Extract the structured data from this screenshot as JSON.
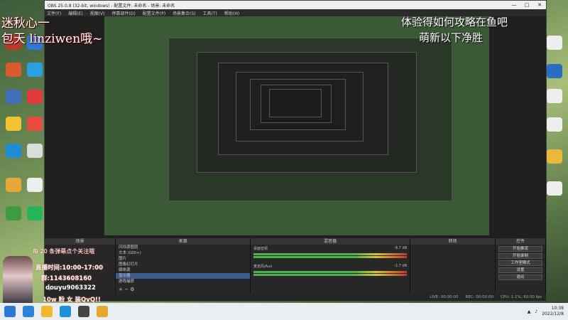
{
  "window": {
    "title": "OBS 25.0.8 (32-bit, windows) - 配置文件: 未命名 - 场景: 未命名",
    "controls": [
      "—",
      "□",
      "✕"
    ]
  },
  "menu": [
    "文件(F)",
    "编辑(E)",
    "视图(V)",
    "停靠部件(D)",
    "配置文件(P)",
    "场景集合(S)",
    "工具(T)",
    "帮助(H)"
  ],
  "overlay": {
    "left_line1": "迷秋心一",
    "left_line2": "包天 linziwen哦~",
    "left_line3": "linziwen哦~",
    "right_line1": "体验得如何攻略在鱼吧",
    "right_line2": "萌新以下净胜"
  },
  "docks": {
    "scenes_title": "场景",
    "sources_title": "来源",
    "mixer_title": "混音器",
    "transitions_title": "转场",
    "controls_title": "控件"
  },
  "sources": [
    "闪烁源图层",
    "文本 (GDI+)",
    "图片",
    "图像幻灯片",
    "媒体源",
    "图片",
    "显示器",
    "游戏捕获"
  ],
  "mixer": {
    "ch1": "桌面音频",
    "ch1_db": "-9.7 dB",
    "ch2": "麦克风/Aux",
    "ch2_db": "-1.7 dB"
  },
  "controls": [
    "开始推流",
    "开始录制",
    "工作室模式",
    "设置",
    "退出"
  ],
  "statusbar": {
    "live": "LIVE: 00:00:00",
    "rec": "REC: 00:00:00",
    "cpu": "CPU: 1.1%, 60.00 fps"
  },
  "card": {
    "t1": "每 20 条弹幕点个关注哦",
    "t2": "直播时间:10:00-17:00",
    "t3": "群:1143608160",
    "t4": "douyu9063322",
    "t5": "10w 粉 女 装QvQ!!"
  },
  "clock": {
    "time": "10:38",
    "date": "2022/12/8"
  },
  "colors": {
    "accent": "#3c5a8a",
    "meter_green": "#4caf50",
    "meter_yellow": "#d6c23a",
    "meter_red": "#c0392b"
  }
}
